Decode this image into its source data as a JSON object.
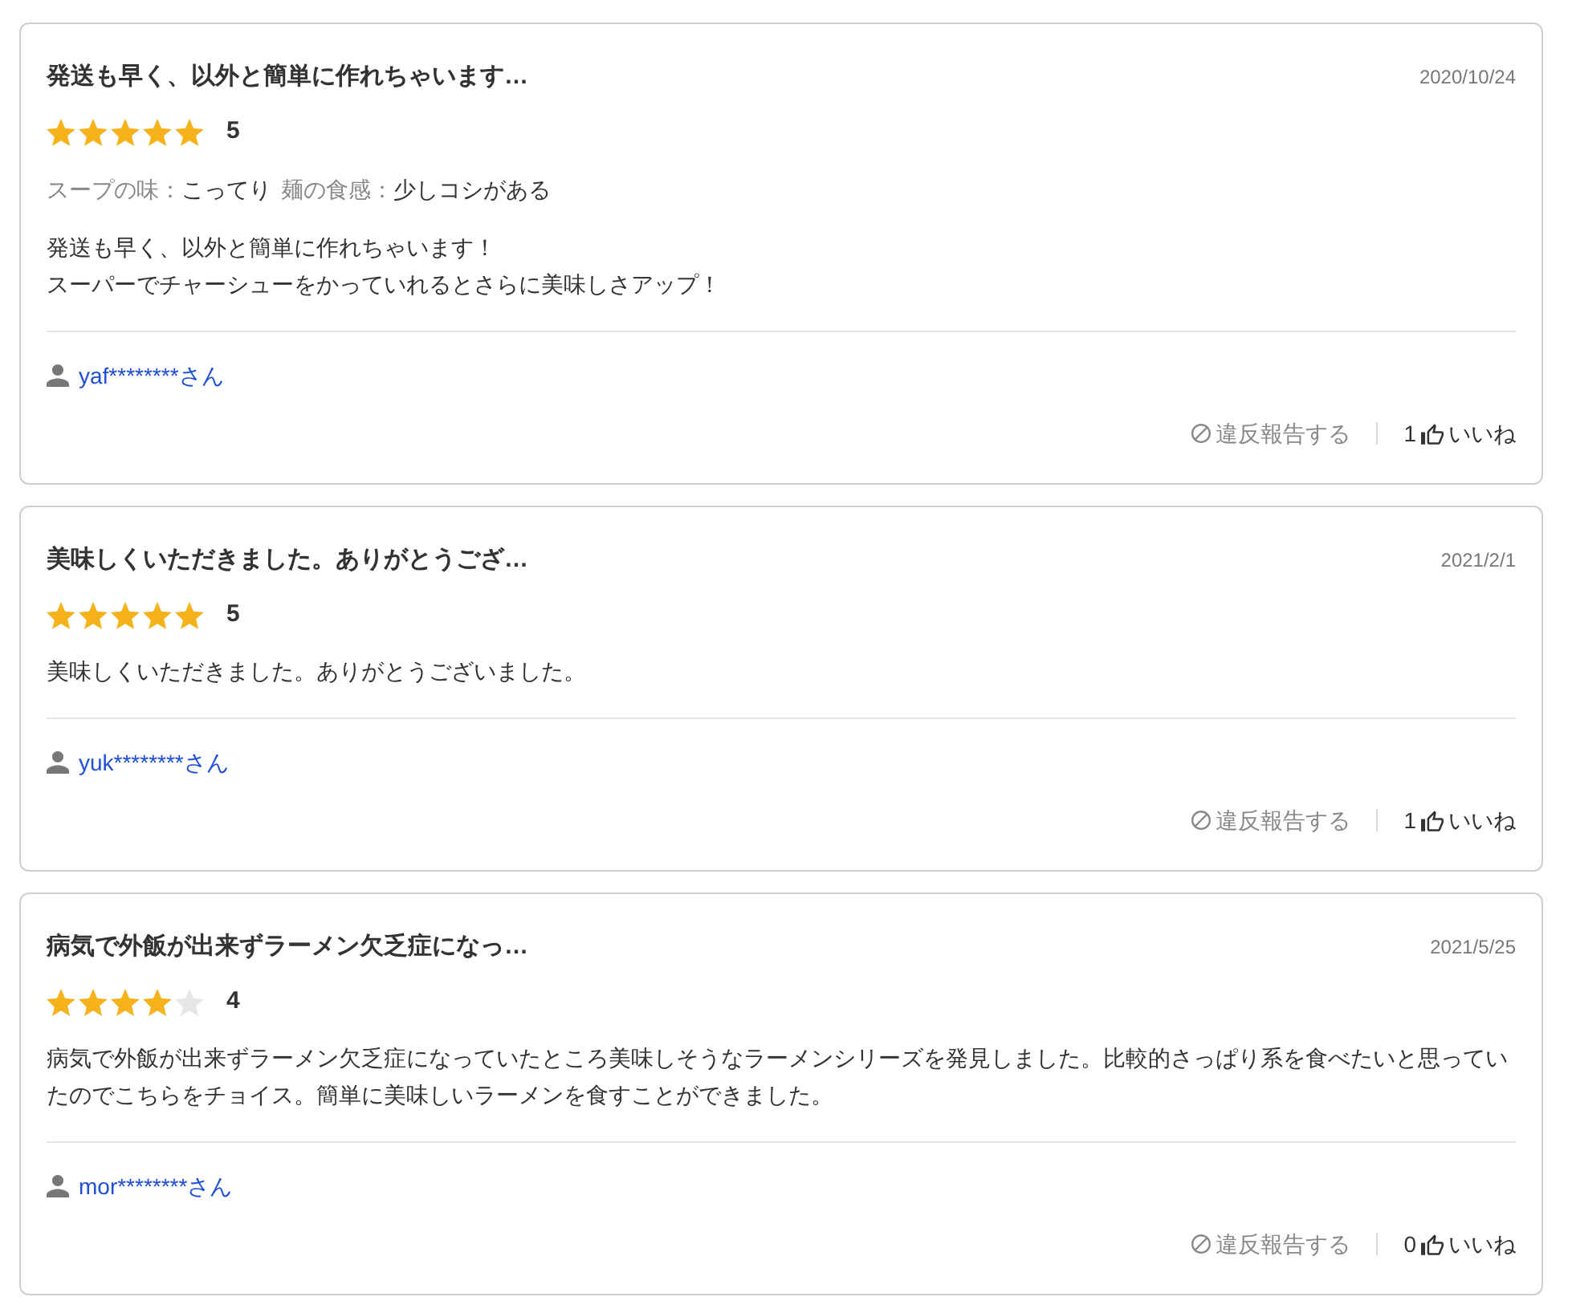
{
  "reviews": [
    {
      "title": "発送も早く、以外と簡単に作れちゃいます…",
      "date": "2020/10/24",
      "stars": 5,
      "rating": "5",
      "attributes": [
        {
          "label": "スープの味：",
          "value": "こってり"
        },
        {
          "label": "麺の食感：",
          "value": "少しコシがある"
        }
      ],
      "body": [
        "発送も早く、以外と簡単に作れちゃいます！",
        "スーパーでチャーシューをかっていれるとさらに美味しさアップ！"
      ],
      "user": "yaf********さん",
      "report": "違反報告する",
      "likes": "1",
      "like_label": "いいね"
    },
    {
      "title": "美味しくいただきました。ありがとうござ…",
      "date": "2021/2/1",
      "stars": 5,
      "rating": "5",
      "body": [
        "美味しくいただきました。ありがとうございました。"
      ],
      "user": "yuk********さん",
      "report": "違反報告する",
      "likes": "1",
      "like_label": "いいね"
    },
    {
      "title": "病気で外飯が出来ずラーメン欠乏症になっ…",
      "date": "2021/5/25",
      "stars": 4,
      "rating": "4",
      "body": [
        "病気で外飯が出来ずラーメン欠乏症になっていたところ美味しそうなラーメンシリーズを発見しました。比較的さっぱり系を食べたいと思っていたのでこちらをチョイス。簡単に美味しいラーメンを食すことができました。"
      ],
      "user": "mor********さん",
      "report": "違反報告する",
      "likes": "0",
      "like_label": "いいね"
    }
  ]
}
